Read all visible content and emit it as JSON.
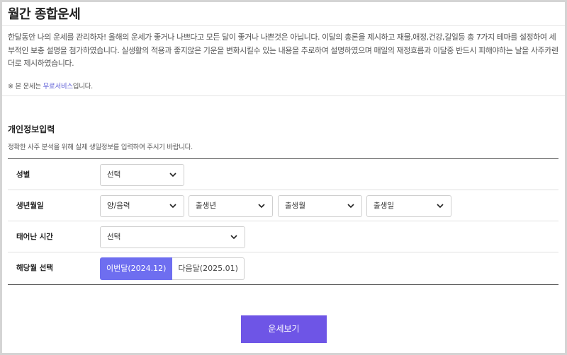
{
  "page": {
    "title": "월간 종합운세",
    "intro": "한달동안 나의 운세를 관리하자! 올해의 운세가 좋거나 나쁘다고 모든 달이 좋거나 나쁜것은 아닙니다. 이달의 총론을 제시하고 재물,애정,건강,길일등 총 7가지 테마를 설정하여 세부적인 보충 설명을 첨가하였습니다. 실생활의 적용과 좋지않은 기운을 변화시킬수 있는 내용을 추로하여 설명하였으며 매일의 재정흐름과 이달중 반드시 피해야하는 날을 사주카렌더로 제시하였습니다.",
    "notice_prefix": "※ 본 운세는 ",
    "notice_free": "무료서비스",
    "notice_suffix": "입니다."
  },
  "section": {
    "title": "개인정보입력",
    "desc": "정확한 사주 분석을 위해 실제 생일정보를 입력하여 주시기 바랍니다."
  },
  "form": {
    "gender": {
      "label": "성별",
      "value": "선택"
    },
    "birth": {
      "label": "생년월일",
      "calendar": "양/음력",
      "year": "출생년",
      "month": "출생월",
      "day": "출생일"
    },
    "time": {
      "label": "태어난 시간",
      "value": "선택"
    },
    "target_month": {
      "label": "해당월 선택",
      "current": "이번달(2024.12)",
      "next": "다음달(2025.01)"
    }
  },
  "submit_label": "운세보기",
  "colors": {
    "accent": "#6e55e6",
    "active_tab": "#6e6ef0"
  }
}
